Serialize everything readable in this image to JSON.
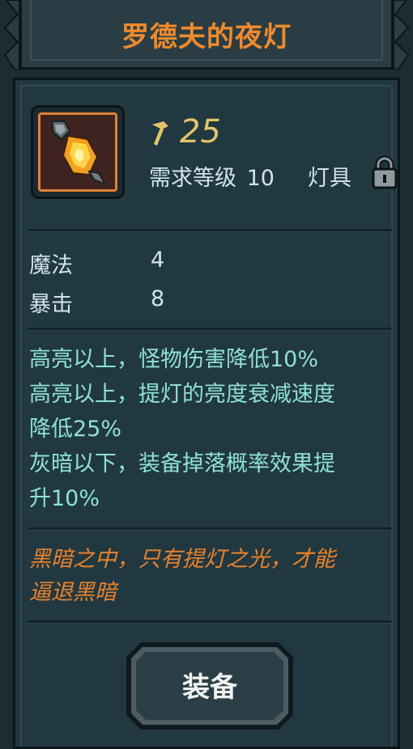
{
  "title": "罗德夫的夜灯",
  "item": {
    "icon": "lantern-gem-icon",
    "level": "25",
    "requirement_label": "需求等级",
    "requirement_level": "10",
    "type": "灯具",
    "locked": true
  },
  "stats": [
    {
      "name": "魔法",
      "value": "4"
    },
    {
      "name": "暴击",
      "value": "8"
    }
  ],
  "effects": [
    "高亮以上，怪物伤害降低10%",
    "高亮以上，提灯的亮度衰减速度",
    "降低25%",
    "灰暗以下，装备掉落概率效果提",
    "升10%"
  ],
  "flavor": [
    "黑暗之中，只有提灯之光，才能",
    "逼退黑暗"
  ],
  "button": {
    "label": "装备"
  },
  "colors": {
    "title": "#f08a2c",
    "level": "#e3c46a",
    "effect": "#8fe0d8",
    "flavor": "#e9822c",
    "panel": "#213840"
  }
}
